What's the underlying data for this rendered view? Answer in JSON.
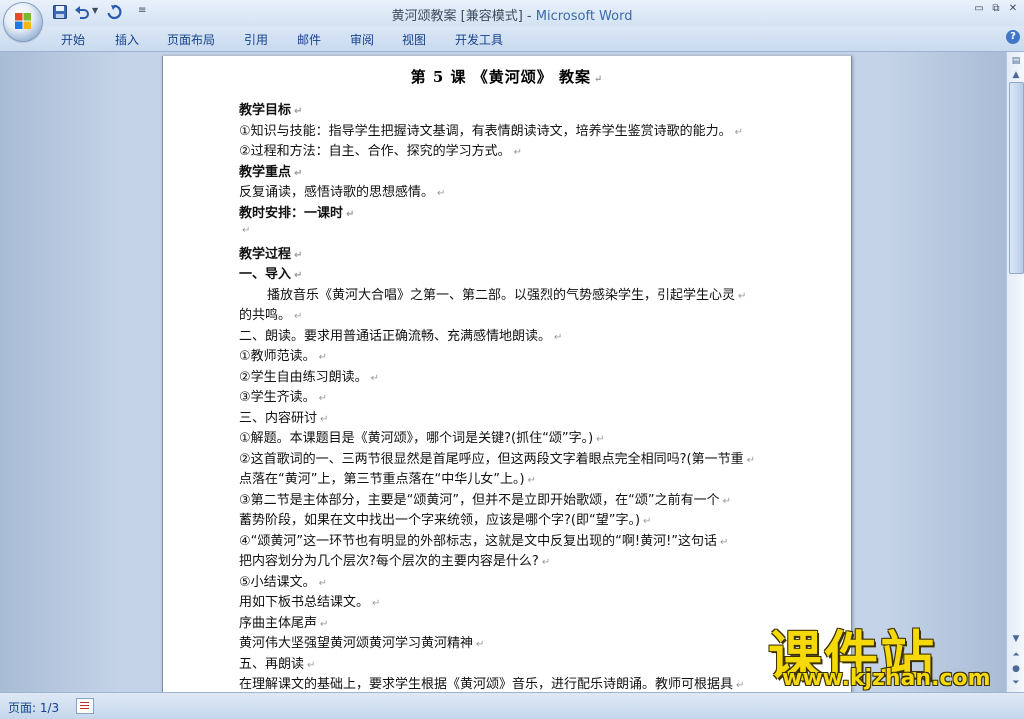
{
  "window": {
    "title_doc": "黄河颂教案 [兼容模式] - ",
    "title_app": "Microsoft Word",
    "minimize_glyph": "▭",
    "maximize_glyph": "⧉",
    "close_glyph": "✕"
  },
  "quick_access": {
    "icons": [
      "save-icon",
      "undo-icon",
      "redo-icon",
      "customize-icon"
    ],
    "customize_glyph": "≡"
  },
  "ribbon": {
    "tabs": [
      "开始",
      "插入",
      "页面布局",
      "引用",
      "邮件",
      "审阅",
      "视图",
      "开发工具"
    ],
    "help_glyph": "?"
  },
  "document": {
    "title": "第 5 课 《黄河颂》 教案",
    "paragraph_mark": "↵",
    "lines": [
      {
        "text": "教学目标",
        "bold": true
      },
      {
        "text": "①知识与技能：指导学生把握诗文基调，有表情朗读诗文，培养学生鉴赏诗歌的能力。",
        "bold": false
      },
      {
        "text": "②过程和方法：自主、合作、探究的学习方式。",
        "bold": false
      },
      {
        "text": "教学重点",
        "bold": true
      },
      {
        "text": "反复诵读，感悟诗歌的思想感情。",
        "bold": false
      },
      {
        "text": "教时安排：一课时",
        "bold": true
      },
      {
        "text": "",
        "bold": false
      },
      {
        "text": "教学过程",
        "bold": true
      },
      {
        "text": "一、导入",
        "bold": true
      },
      {
        "text": "播放音乐《黄河大合唱》之第一、第二部。以强烈的气势感染学生，引起学生心灵",
        "bold": false,
        "indent": true
      },
      {
        "text": "的共鸣。",
        "bold": false
      },
      {
        "text": "二、朗读。要求用普通话正确流畅、充满感情地朗读。",
        "bold": false
      },
      {
        "text": "①教师范读。",
        "bold": false
      },
      {
        "text": "②学生自由练习朗读。",
        "bold": false
      },
      {
        "text": "③学生齐读。",
        "bold": false
      },
      {
        "text": "三、内容研讨",
        "bold": false
      },
      {
        "text": "①解题。本课题目是《黄河颂》，哪个词是关键?(抓住“颂”字。)",
        "bold": false
      },
      {
        "text": "②这首歌词的一、三两节很显然是首尾呼应，但这两段文字着眼点完全相同吗?(第一节重",
        "bold": false
      },
      {
        "text": "点落在“黄河”上，第三节重点落在“中华儿女”上。)",
        "bold": false
      },
      {
        "text": "③第二节是主体部分，主要是“颂黄河”，但并不是立即开始歌颂，在“颂”之前有一个",
        "bold": false
      },
      {
        "text": "蓄势阶段，如果在文中找出一个字来统领，应该是哪个字?(即“望”字。)",
        "bold": false
      },
      {
        "text": "④“颂黄河”这一环节也有明显的外部标志，这就是文中反复出现的“啊!黄河!”这句话",
        "bold": false
      },
      {
        "text": "把内容划分为几个层次?每个层次的主要内容是什么?",
        "bold": false
      },
      {
        "text": "⑤小结课文。",
        "bold": false
      },
      {
        "text": "用如下板书总结课文。",
        "bold": false
      },
      {
        "text": "序曲主体尾声",
        "bold": false
      },
      {
        "text": "黄河伟大坚强望黄河颂黄河学习黄河精神",
        "bold": false
      },
      {
        "text": "五、再朗读",
        "bold": false
      },
      {
        "text": "在理解课文的基础上，要求学生根据《黄河颂》音乐，进行配乐诗朗诵。教师可根据具",
        "bold": false
      }
    ]
  },
  "scrollbar": {
    "up_glyph": "▲",
    "down_glyph": "▼",
    "prev_page_glyph": "⏶",
    "browse_glyph": "●",
    "next_page_glyph": "⏷"
  },
  "status": {
    "page_indicator": "页面: 1/3"
  },
  "watermark": {
    "title": "课件站",
    "url": "www.kjzhan.com"
  }
}
